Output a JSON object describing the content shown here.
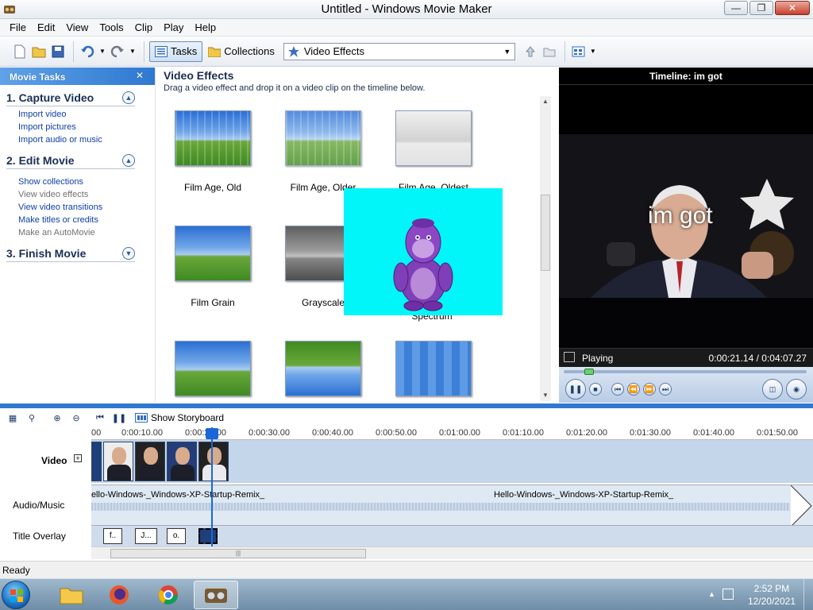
{
  "window": {
    "title": "Untitled - Windows Movie Maker"
  },
  "menu": [
    "File",
    "Edit",
    "View",
    "Tools",
    "Clip",
    "Play",
    "Help"
  ],
  "toolbar": {
    "tasks_label": "Tasks",
    "collections_label": "Collections",
    "collection_select": "Video Effects"
  },
  "tasks": {
    "header": "Movie Tasks",
    "sections": [
      {
        "title": "1. Capture Video",
        "links": [
          "Import video",
          "Import pictures",
          "Import audio or music"
        ]
      },
      {
        "title": "2. Edit Movie",
        "links": [
          "Show collections",
          "View video effects",
          "View video transitions",
          "Make titles or credits",
          "Make an AutoMovie"
        ]
      },
      {
        "title": "3. Finish Movie",
        "links": []
      }
    ]
  },
  "effects": {
    "title": "Video Effects",
    "subtitle": "Drag a video effect and drop it on a video clip on the timeline below.",
    "items": [
      "Film Age, Old",
      "Film Age, Older",
      "Film Age, Oldest",
      "Film Grain",
      "Grayscale",
      "Spectrum"
    ]
  },
  "preview": {
    "title": "Timeline: im got",
    "caption": "im got",
    "state": "Playing",
    "time": "0:00:21.14 / 0:04:07.27"
  },
  "timeline": {
    "show_storyboard": "Show Storyboard",
    "ruler_labels": [
      "00",
      "0:00:10.00",
      "0:00:20.00",
      "0:00:30.00",
      "0:00:40.00",
      "0:00:50.00",
      "0:01:00.00",
      "0:01:10.00",
      "0:01:20.00",
      "0:01:30.00",
      "0:01:40.00",
      "0:01:50.00"
    ],
    "video_label": "Video",
    "audio_label": "Audio/Music",
    "overlay_label": "Title Overlay",
    "audio_clip_name": "Hello-Windows-_Windows-XP-Startup-Remix_",
    "title_clips": [
      "f..",
      "J...",
      "o."
    ]
  },
  "statusbar": {
    "text": "Ready"
  },
  "taskbar": {
    "time": "2:52 PM",
    "date": "12/20/2021"
  },
  "colors": {
    "accent": "#2f78d1",
    "overlay": "#00f6f8"
  }
}
